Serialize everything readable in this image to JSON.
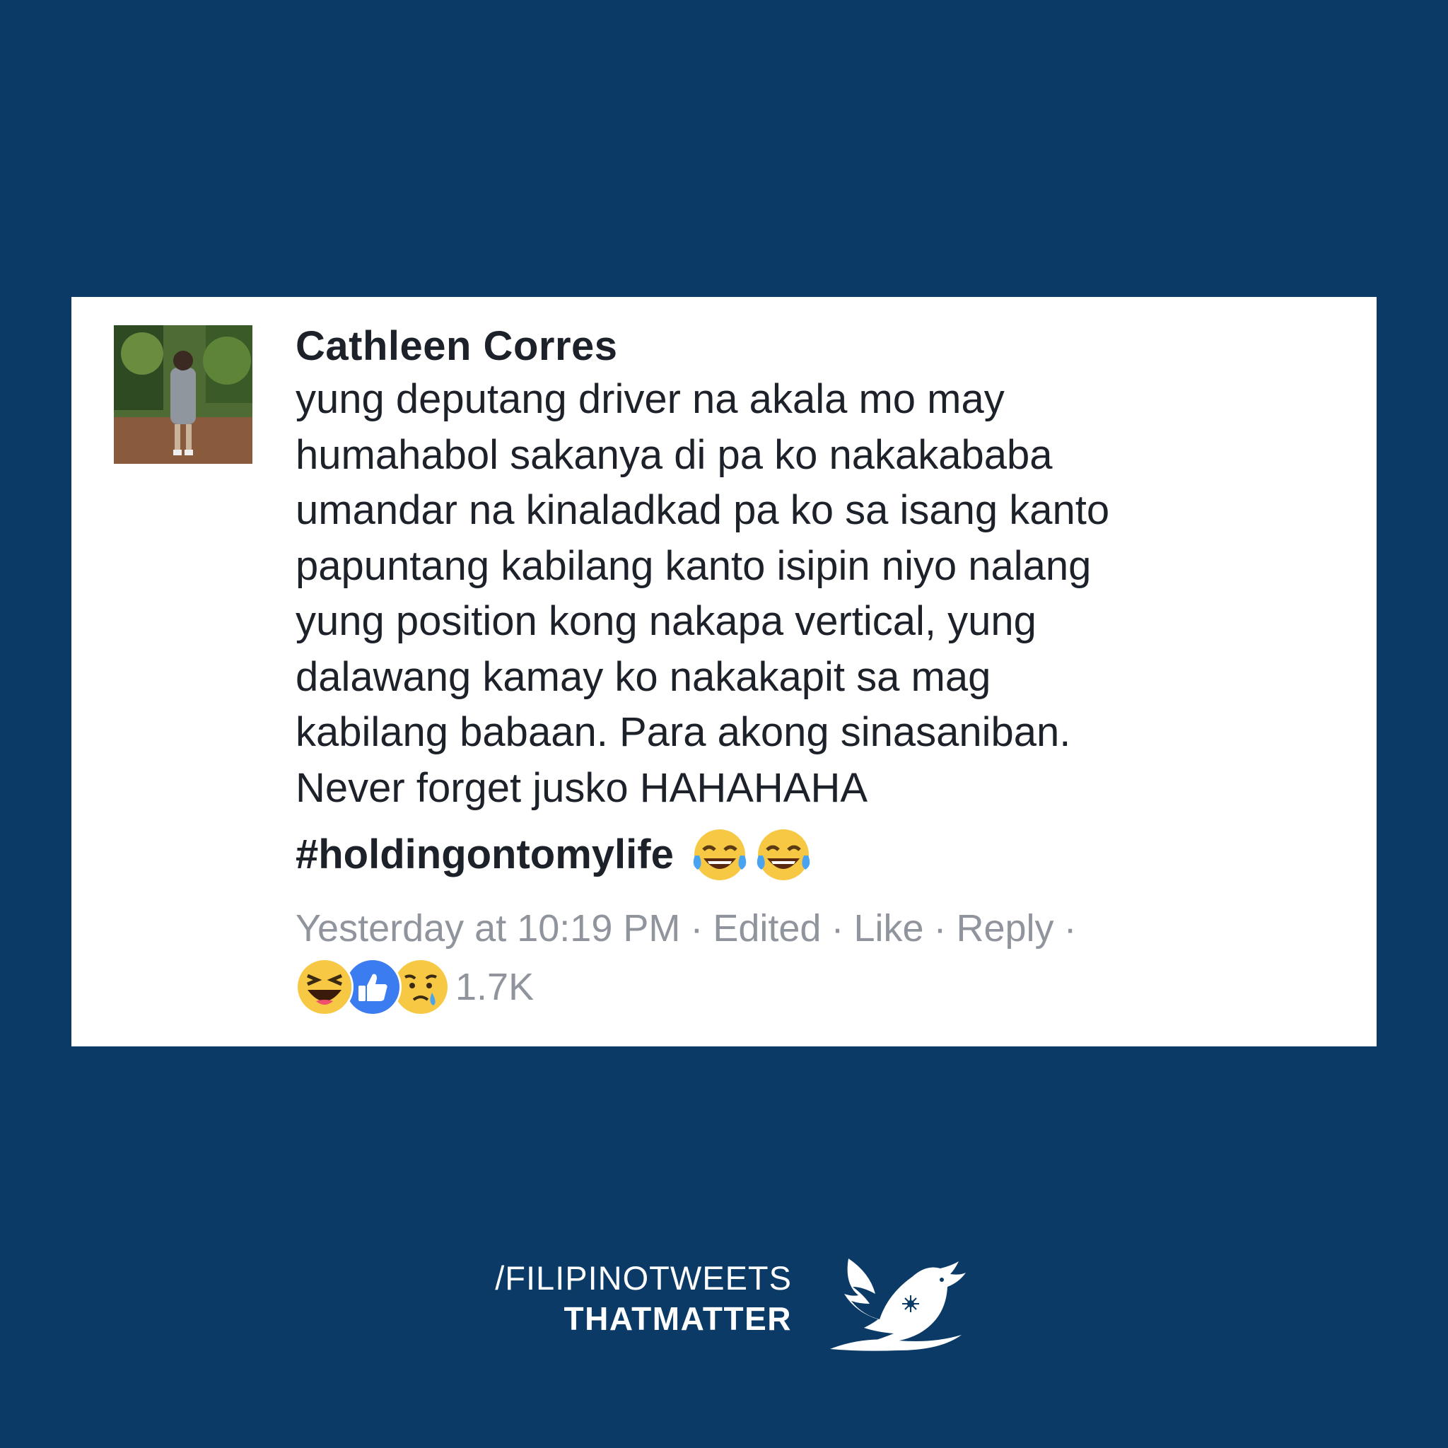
{
  "comment": {
    "author": "Cathleen Corres",
    "lines": [
      "yung deputang driver na akala mo may",
      "humahabol sakanya di pa ko nakakababa",
      "umandar na kinaladkad pa ko sa isang kanto",
      "papuntang kabilang kanto isipin niyo nalang",
      "yung position kong nakapa vertical, yung",
      "dalawang kamay ko nakakapit sa mag",
      "kabilang babaan. Para akong sinasaniban.",
      "Never forget jusko HAHAHAHA"
    ],
    "hashtag": "#holdingontomylife",
    "hashtag_emojis": [
      "tears-of-joy-icon",
      "tears-of-joy-icon"
    ],
    "timestamp": "Yesterday at 10:19 PM",
    "edited_label": "Edited",
    "like_label": "Like",
    "reply_label": "Reply",
    "separator": "·",
    "reactions": [
      "haha-reaction-icon",
      "like-reaction-icon",
      "sad-reaction-icon"
    ],
    "reaction_count": "1.7K"
  },
  "branding": {
    "line1": "/FILIPINOTWEETS",
    "line2": "THATMATTER",
    "logo": "bird-logo-icon"
  },
  "colors": {
    "background": "#0b3a66",
    "card": "#ffffff",
    "text": "#1d2129",
    "meta": "#90949c",
    "like_blue": "#3b7cf0",
    "reaction_yellow": "#f7c843"
  }
}
